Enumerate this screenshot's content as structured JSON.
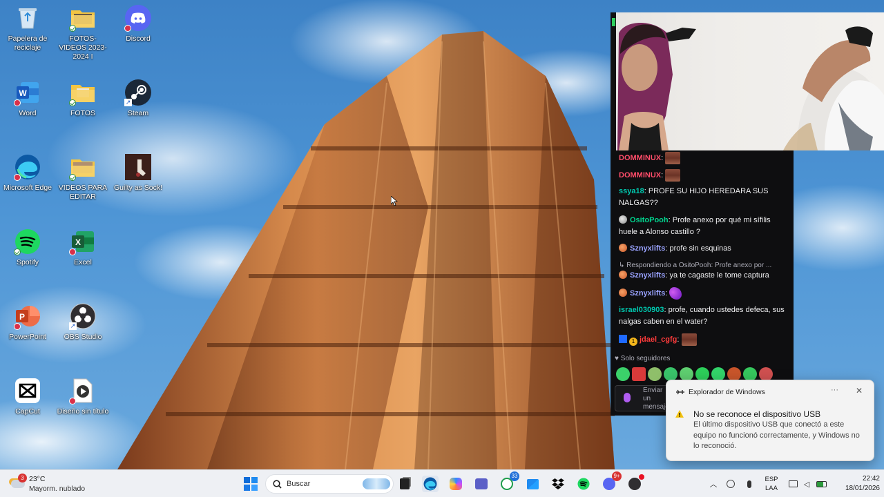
{
  "desktop": {
    "icons": [
      {
        "label": "Papelera de reciclaje",
        "icon": "recycle-bin-icon"
      },
      {
        "label": "FOTOS- VIDEOS 2023-2024 I",
        "icon": "folder-icon"
      },
      {
        "label": "Discord",
        "icon": "discord-icon"
      },
      {
        "label": "Word",
        "icon": "word-icon"
      },
      {
        "label": "FOTOS",
        "icon": "folder-icon"
      },
      {
        "label": "Steam",
        "icon": "steam-icon"
      },
      {
        "label": "Microsoft Edge",
        "icon": "edge-icon"
      },
      {
        "label": "VIDEOS PARA EDITAR",
        "icon": "folder-icon"
      },
      {
        "label": "Guilty as Sock!",
        "icon": "game-icon"
      },
      {
        "label": "Spotify",
        "icon": "spotify-icon"
      },
      {
        "label": "Excel",
        "icon": "excel-icon"
      },
      {
        "label": "PowerPoint",
        "icon": "powerpoint-icon"
      },
      {
        "label": "OBS Studio",
        "icon": "obs-icon"
      },
      {
        "label": "CapCut",
        "icon": "capcut-icon"
      },
      {
        "label": "Diseño sin título",
        "icon": "video-file-icon"
      }
    ]
  },
  "chat": {
    "messages": [
      {
        "user": "DOMMINUX",
        "text": "",
        "color": "#ff4d6a"
      },
      {
        "user": "DOMMINUX",
        "text": "",
        "color": "#ff4d6a"
      },
      {
        "user": "ssya18",
        "text": "PROFE SU HIJO HEREDARA SUS NALGAS??",
        "color": "#00c8af"
      },
      {
        "user": "OsitoPooh",
        "text": "Profe anexo por qué mi sífilis huele a Alonso castillo ?",
        "color": "#00d68f"
      },
      {
        "user": "Sznyxlifts",
        "text": "profe sin esquinas",
        "color": "#9aa3ff"
      },
      {
        "user": "Sznyxlifts",
        "text": "ya te cagaste le tome captura",
        "color": "#9aa3ff"
      },
      {
        "user": "Sznyxlifts",
        "text": "",
        "color": "#9aa3ff"
      },
      {
        "user": "israel030903",
        "text": "profe, cuando ustedes defeca, sus nalgas caben en el water?",
        "color": "#00c8af"
      },
      {
        "user": "jdael_cgfg",
        "text": "",
        "color": "#ff3b3b"
      }
    ],
    "reply_context": "Respondiendo a OsitoPooh: Profe anexo por ...",
    "followers_only": "Solo seguidores",
    "input_placeholder": "Enviar un mensaje",
    "badge_number": "1"
  },
  "toast": {
    "app_name": "Explorador de Windows",
    "title": "No se reconoce el dispositivo USB",
    "body": "El último dispositivo USB que conectó a este equipo no funcionó correctamente, y Windows no lo reconoció.",
    "more_label": "···",
    "close_label": "✕"
  },
  "taskbar": {
    "weather_temp": "23°C",
    "weather_desc": "Mayorm. nublado",
    "weather_badge": "3",
    "search_placeholder": "Buscar",
    "whatsapp_badge": "33",
    "discord_badge": "9+",
    "lang_line1": "ESP",
    "lang_line2": "LAA",
    "time": "22:42",
    "date": "18/01/2026"
  },
  "colors": {
    "chat_bg": "#0e0e10",
    "taskbar_bg": "#eef0f4",
    "toast_bg": "#f3f3f3"
  }
}
